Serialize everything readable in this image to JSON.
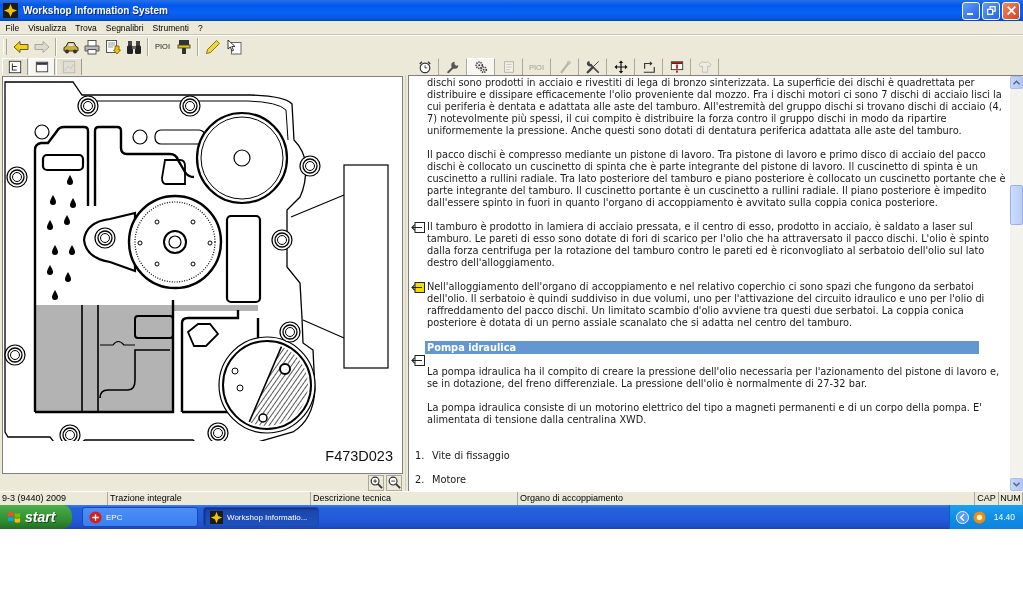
{
  "window": {
    "title": "Workshop Information System"
  },
  "menu": [
    "File",
    "Visualizza",
    "Trova",
    "Segnalibri",
    "Strumenti",
    "?"
  ],
  "toolbar": {
    "groups": [
      [
        {
          "disabled": false
        },
        {
          "disabled": true
        }
      ],
      [
        {
          "disabled": false
        },
        {
          "disabled": false
        },
        {
          "disabled": false
        },
        {
          "disabled": false
        }
      ],
      [
        {
          "label": "PIOI",
          "disabled": false
        },
        {
          "disabled": false
        }
      ],
      [
        {
          "disabled": false
        },
        {
          "disabled": false
        }
      ]
    ]
  },
  "left_tabs": [
    {
      "selected": false,
      "disabled": false
    },
    {
      "selected": true,
      "disabled": false
    },
    {
      "selected": false,
      "disabled": true
    }
  ],
  "right_tabs": [
    {
      "selected": false,
      "disabled": false
    },
    {
      "selected": false,
      "disabled": false
    },
    {
      "selected": true,
      "disabled": false
    },
    {
      "selected": false,
      "disabled": true
    },
    {
      "label": "PIOI",
      "selected": false,
      "disabled": true
    },
    {
      "selected": false,
      "disabled": true
    },
    {
      "selected": false,
      "disabled": false
    },
    {
      "selected": false,
      "disabled": false
    },
    {
      "selected": false,
      "disabled": false
    },
    {
      "selected": false,
      "disabled": false
    },
    {
      "selected": false,
      "disabled": true
    }
  ],
  "figure": {
    "caption": "F473D023"
  },
  "document": {
    "blocks": [
      {
        "kind": "paragraph",
        "text": "dischi sono prodotti in acciaio e rivestiti di lega di bronzo sinterizzata. La superficie dei dischi è quadrettata per distribuire e dissipare efficacemente l'olio proveniente dal mozzo. Fra i dischi motori ci sono 7 dischi di acciaio lisci la cui periferia è dentata e adattata alle aste del tamburo. All'estremità del gruppo dischi si trovano dischi di acciaio (4, 7) notevolmente più spessi, il cui compito è distribuire la forza contro il gruppo dischi in modo da ripartire uniformemente la pressione. Anche questi sono dotati di dentatura periferica adattata alle aste del tamburo."
      },
      {
        "kind": "paragraph",
        "text": "Il pacco dischi è compresso mediante un pistone di lavoro. Tra pistone di lavoro e primo disco di acciaio del pacco dischi è collocato un cuscinetto di spinta che è parte integrante del pistone di lavoro. Il cuscinetto di spinta è un cuscinetto a rullini radiale. Tra lato posteriore del tamburo e piano posteriore è collocato un cuscinetto portante che è parte integrante del tamburo. Il cuscinetto portante è un cuscinetto a rullini radiale. Il piano posteriore è impedito dall'essere spinto in fuori in quanto l'organo di accoppiamento è avvitato sulla coppia conica posteriore."
      },
      {
        "kind": "paragraph",
        "marker": {
          "highlighted": false
        },
        "text": "Il tamburo è prodotto in lamiera di acciaio pressata, e il centro di esso, prodotto in acciaio, è saldato a laser sul tamburo. Le pareti di esso sono dotate di fori di scarico per l'olio che ha attraversato il pacco dischi. L'olio è spinto dalla forza centrifuga per la rotazione del tamburo contro le pareti ed è riconvogliato al serbatoio dell'olio sul lato destro dell'alloggiamento."
      },
      {
        "kind": "paragraph",
        "marker": {
          "highlighted": true
        },
        "text": "Nell'alloggiamento dell'organo di accoppiamento e nel relativo coperchio ci sono spazi che fungono da serbatoi dell'olio. Il serbatoio è quindi suddiviso in due volumi, uno per l'attivazione del circuito idraulico e uno per l'olio di raffreddamento del pacco dischi. Un limitato scambio d'olio avviene tra questi due serbatoi. La coppia conica posteriore è dotata di un perno assiale scanalato che si adatta nel centro del tamburo."
      },
      {
        "kind": "heading",
        "marker": {
          "highlighted": false
        },
        "text": "Pompa idraulica"
      },
      {
        "kind": "paragraph",
        "text": "La pompa idraulica ha il compito di creare la pressione dell'olio necessaria per l'azionamento del pistone di lavoro e, se in dotazione, del freno differenziale. La pressione dell'olio è normalmente di 27-32 bar."
      },
      {
        "kind": "paragraph",
        "text": "La pompa idraulica consiste di un motorino elettrico del tipo a magneti permanenti e di un corpo della pompa. E' alimentata di tensione dalla centralina XWD."
      },
      {
        "kind": "list_item",
        "number": "1.",
        "text": "Vite di fissaggio"
      },
      {
        "kind": "list_item",
        "number": "2.",
        "text": "Motore"
      }
    ]
  },
  "status_bar": [
    "9-3 (9440) 2009",
    "Trazione integrale",
    "Descrizione tecnica",
    "Organo di accoppiamento",
    "CAP",
    "NUM"
  ],
  "taskbar": {
    "start": "start",
    "tasks": [
      {
        "label": "EPC",
        "selected": false
      },
      {
        "label": "Workshop Informatio...",
        "selected": true
      }
    ],
    "clock": "14.40"
  }
}
